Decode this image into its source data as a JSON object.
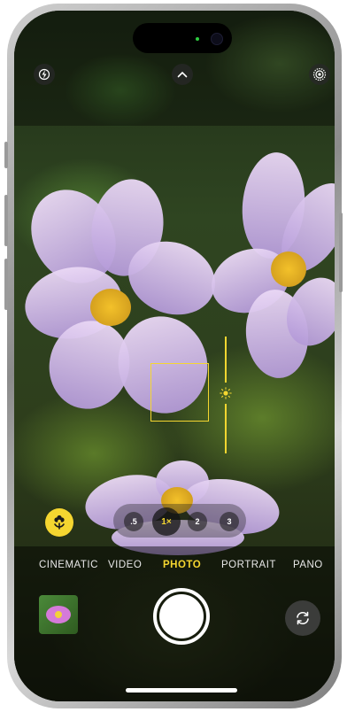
{
  "top_bar": {
    "flash_icon": "flash-icon",
    "controls_icon": "chevron-up-icon",
    "live_photo_icon": "live-photo-icon"
  },
  "viewfinder": {
    "focus_color": "#f5d630",
    "exposure_icon": "sun-icon"
  },
  "macro": {
    "icon": "macro-flower-icon",
    "color": "#f5d630"
  },
  "zoom": {
    "options": [
      ".5",
      "1×",
      "2",
      "3"
    ],
    "selected": "1×"
  },
  "modes": {
    "items": [
      "CINEMATIC",
      "VIDEO",
      "PHOTO",
      "PORTRAIT",
      "PANO"
    ],
    "active": "PHOTO",
    "active_color": "#f5d630"
  },
  "bottom": {
    "thumbnail_icon": "last-photo-thumbnail",
    "shutter_icon": "shutter-icon",
    "flip_icon": "camera-flip-icon"
  }
}
